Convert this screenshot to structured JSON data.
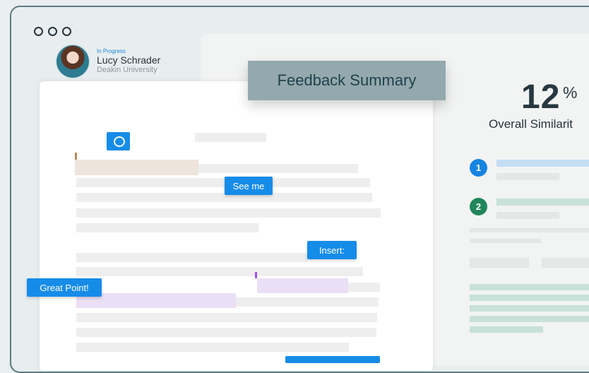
{
  "student": {
    "status": "In Progress",
    "name": "Lucy Schrader",
    "university": "Deakin University"
  },
  "comments": {
    "see_me": "See me",
    "insert": "Insert:",
    "great_point": "Great Point!"
  },
  "summary": {
    "title": "Feedback Summary"
  },
  "similarity": {
    "value": "12",
    "unit": "%",
    "label": "Overall Similarit"
  },
  "matches": [
    {
      "number": "1"
    },
    {
      "number": "2"
    }
  ]
}
